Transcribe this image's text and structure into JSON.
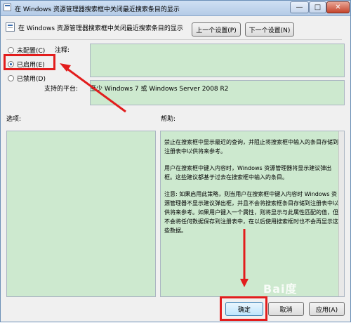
{
  "window": {
    "title": "在 Windows 资源管理器搜索框中关闭最近搜索条目的显示",
    "controls": {
      "minimize": "—",
      "maximize": "□",
      "close": "✕"
    }
  },
  "header": {
    "title": "在 Windows 资源管理器搜索框中关闭最近搜索条目的显示",
    "prev_button": "上一个设置(P)",
    "next_button": "下一个设置(N)"
  },
  "options": {
    "not_configured": "未配置(C)",
    "enabled": "已启用(E)",
    "disabled": "已禁用(D)",
    "selected": "enabled"
  },
  "comment": {
    "label": "注释:"
  },
  "support": {
    "label": "支持的平台:",
    "value": "至少 Windows 7 或 Windows Server 2008 R2"
  },
  "options_section": {
    "label": "选项:"
  },
  "help_section": {
    "label": "帮助:",
    "paragraphs": [
      "禁止在搜索框中显示最近的查询，并阻止将搜索框中输入的条目存储到注册表中以供将来参考。",
      "用户在搜索框中键入内容时，Windows 资源管理器将显示建议弹出框。这些建议都基于过去在搜索框中输入的条目。",
      "注意: 如果启用此策略，则当用户在搜索框中键入内容时 Windows 资源管理器不显示建议弹出框，并且不会将搜索框条目存储到注册表中以供将来参考。如果用户键入一个属性，则将显示与此属性匹配的值，但不会将任何数据保存到注册表中，在以后使用搜索框时也不会再显示这些数据。"
    ]
  },
  "footer": {
    "ok": "确定",
    "cancel": "取消",
    "apply": "应用(A)"
  },
  "watermark": {
    "text": "Bai度"
  },
  "colors": {
    "panel_green": "#cde9cf",
    "annotation_red": "#e21d1d",
    "window_bg": "#f0f0f0"
  }
}
